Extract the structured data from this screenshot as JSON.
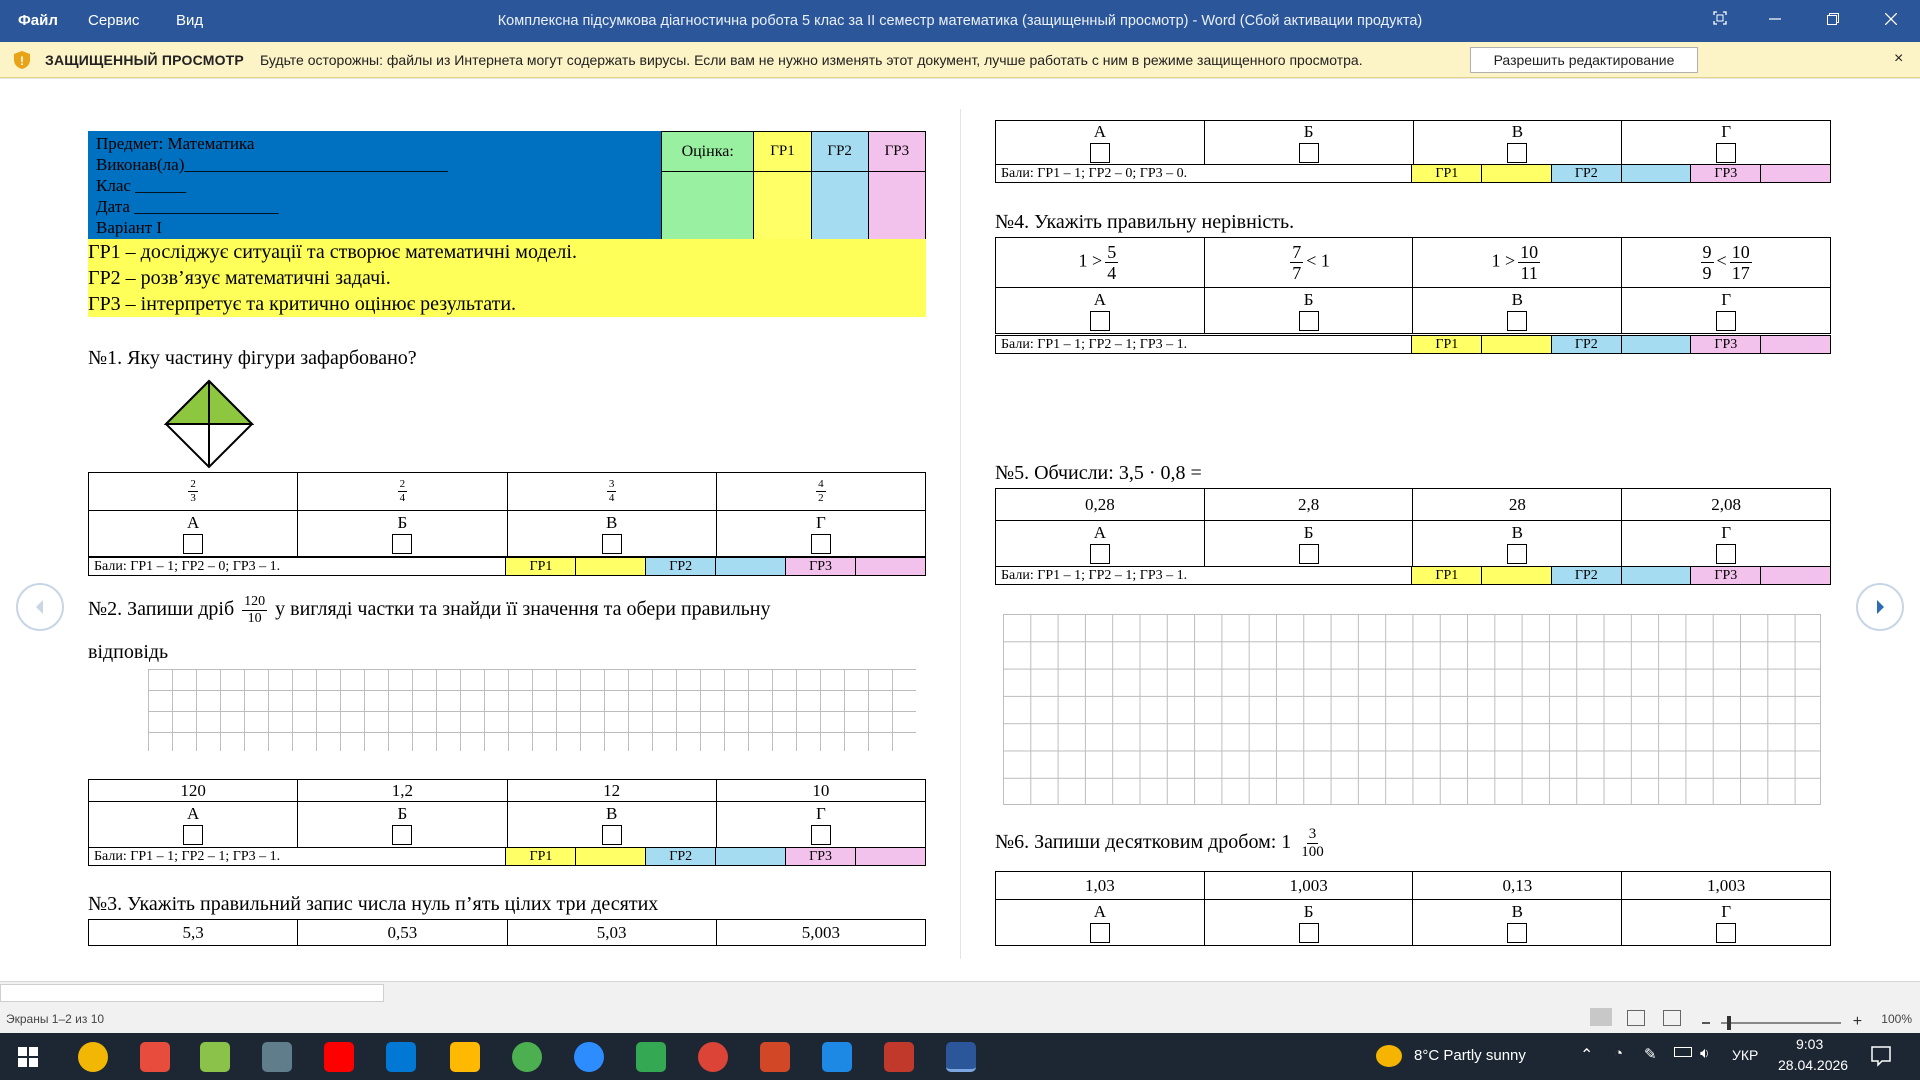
{
  "titlebar": {
    "menu_file": "Файл",
    "menu_service": "Сервис",
    "menu_view": "Вид",
    "title": "Комплексна підсумкова діагностична робота 5 клас за ІІ семестр математика (защищенный просмотр) - Word (Сбой активации продукта)"
  },
  "protected_view": {
    "heading": "ЗАЩИЩЕННЫЙ ПРОСМОТР",
    "message": "Будьте осторожны: файлы из Интернета могут содержать вирусы. Если вам не нужно изменять этот документ, лучше работать с ним в режиме защищенного просмотра.",
    "enable_button": "Разрешить редактирование",
    "close": "×"
  },
  "header": {
    "subject": "Предмет: Математика",
    "performer": "Виконав(ла)_______________________________",
    "class": "Клас ______",
    "date": "Дата _________________",
    "variant": "Варіант І",
    "grade_label": "Оцінка:",
    "gr1": "ГР1",
    "gr2": "ГР2",
    "gr3": "ГР3"
  },
  "groups": [
    "ГР1 – досліджує ситуації та створює математичні моделі.",
    "ГР2 – розв’язує математичні задачі.",
    "ГР3 – інтерпретує та критично оцінює результати."
  ],
  "letters": [
    "А",
    "Б",
    "В",
    "Г"
  ],
  "q1": {
    "text": "№1. Яку частину фігури зафарбовано?",
    "options": [
      {
        "n": "2",
        "d": "3"
      },
      {
        "n": "2",
        "d": "4"
      },
      {
        "n": "3",
        "d": "4"
      },
      {
        "n": "4",
        "d": "2"
      }
    ],
    "score": "Бали: ГР1 – 1; ГР2 – 0; ГР3 – 1."
  },
  "q2": {
    "text_a": "№2. Запиши дріб",
    "frac_n": "120",
    "frac_d": "10",
    "text_b": "у вигляді частки та знайди її значення та обери правильну",
    "text_c": "відповідь",
    "options": [
      "120",
      "1,2",
      "12",
      "10"
    ],
    "score": "Бали: ГР1 – 1; ГР2 – 1; ГР3 – 1."
  },
  "q3": {
    "text": "№3. Укажіть правильний запис числа нуль п’ять цілих три десятих",
    "options": [
      "5,3",
      "0,53",
      "5,03",
      "5,003"
    ],
    "score": "Бали: ГР1 – 1; ГР2 – 0; ГР3 – 0."
  },
  "q4": {
    "text": "№4. Укажіть правильну нерівність.",
    "options": [
      {
        "pre": "1 >",
        "n": "5",
        "d": "4",
        "post": ""
      },
      {
        "pre": "",
        "n": "7",
        "d": "7",
        "post": "< 1"
      },
      {
        "pre": "1 >",
        "n": "10",
        "d": "11",
        "post": ""
      },
      {
        "pre": "",
        "n": "9",
        "d": "9",
        "post": "<",
        "n2": "10",
        "d2": "17"
      }
    ],
    "score": "Бали: ГР1 – 1; ГР2 – 1; ГР3 – 1."
  },
  "q5": {
    "text": "№5. Обчисли: 3,5  ·  0,8 =",
    "options": [
      "0,28",
      "2,8",
      "28",
      "2,08"
    ],
    "score": "Бали: ГР1 – 1; ГР2 – 1; ГР3 – 1."
  },
  "q6": {
    "text": "№6. Запиши десятковим дробом:  1",
    "frac_n": "3",
    "frac_d": "100",
    "options": [
      "1,03",
      "1,003",
      "0,13",
      "1,003"
    ]
  },
  "statusbar": {
    "pages": "Экраны 1–2 из 10",
    "zoom": "100%"
  },
  "taskbar": {
    "weather": "8°C  Partly sunny",
    "lang": "УКР",
    "time": "9:03",
    "date": "28.04.2026"
  },
  "colors": {
    "title_blue": "#2b579a",
    "header_blue": "#0070c0",
    "gr1_yellow": "#ffff66",
    "gr2_blue": "#a6dcf2",
    "gr3_pink": "#f2c2ec",
    "grade_green": "#99f0a0"
  }
}
